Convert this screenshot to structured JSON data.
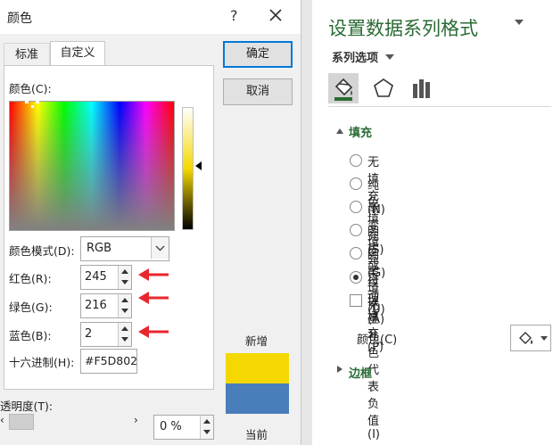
{
  "dialog": {
    "title": "颜色",
    "help": "?",
    "tabs": {
      "standard": "标准",
      "custom": "自定义"
    },
    "colors_label": "颜色(C):",
    "model_label": "颜色模式(D):",
    "model_value": "RGB",
    "red_label": "红色(R):",
    "red_value": "245",
    "green_label": "绿色(G):",
    "green_value": "216",
    "blue_label": "蓝色(B):",
    "blue_value": "2",
    "hex_label": "十六进制(H):",
    "hex_value": "#F5D802",
    "ok": "确定",
    "cancel": "取消",
    "new_label": "新增",
    "current_label": "当前",
    "new_color": "#F5D802",
    "current_color": "#4A7EBB",
    "transparency_label": "透明度(T):",
    "transparency_value": "0 %",
    "arrow_color": "#E8262C"
  },
  "panel": {
    "title": "设置数据系列格式",
    "series_options": "系列选项",
    "tab_icons": [
      "paint-bucket-icon",
      "pentagon-icon",
      "bar-chart-icon"
    ],
    "fill_section": "填充",
    "options": [
      {
        "label": "无填充(N)",
        "selected": false
      },
      {
        "label": "纯色填充(S)",
        "selected": false
      },
      {
        "label": "渐变填充(G)",
        "selected": false
      },
      {
        "label": "图片或纹理填充(P)",
        "selected": false
      },
      {
        "label": "图案填充(A)",
        "selected": false
      },
      {
        "label": "自动(U)",
        "selected": true
      }
    ],
    "invert_label": "以互补色代表负值(I)",
    "color_label": "颜色(C)",
    "border_section": "边框",
    "accent_color": "#2B6B34"
  }
}
